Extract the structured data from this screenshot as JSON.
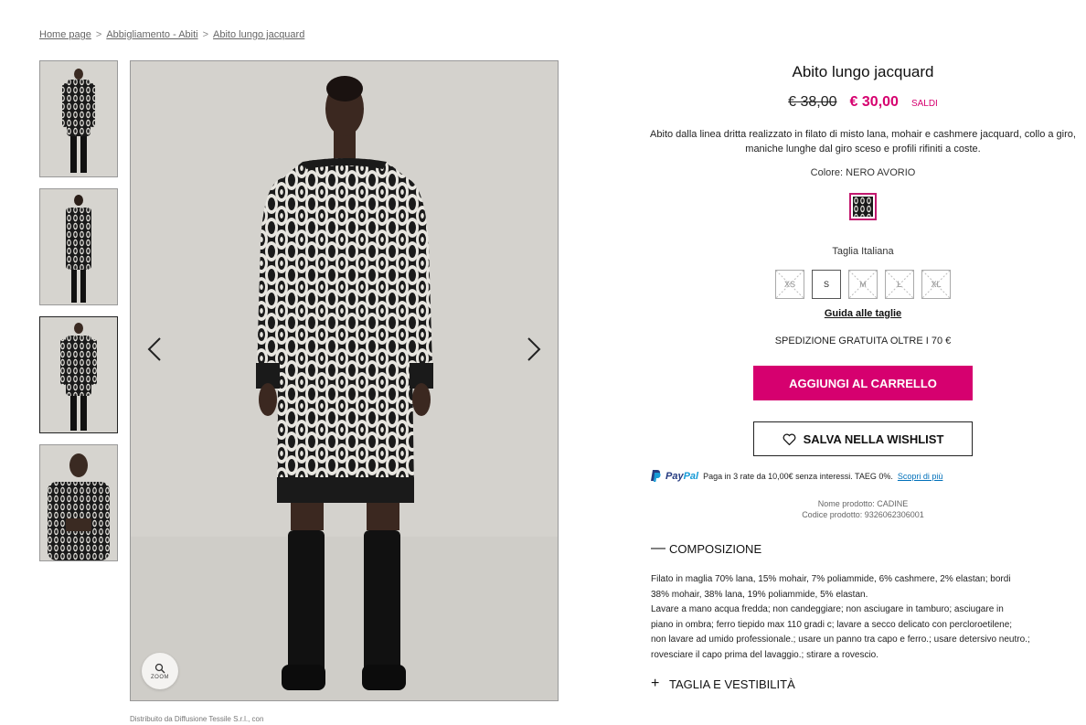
{
  "breadcrumb": {
    "items": [
      "Home page",
      "Abbigliamento - Abiti",
      "Abito lungo jacquard"
    ],
    "separator": ">"
  },
  "gallery": {
    "thumbnails": [
      "front-view",
      "back-view",
      "front-view-2",
      "detail-view"
    ],
    "active_index": 2,
    "zoom_label": "ZOOM",
    "distributed_text": "Distribuito da Diffusione Tessile S.r.l., con"
  },
  "product": {
    "title": "Abito lungo jacquard",
    "old_price": "€ 38,00",
    "new_price": "€ 30,00",
    "sale_label": "SALDI",
    "description": "Abito dalla linea dritta realizzato in filato di misto lana, mohair e cashmere jacquard, collo a giro, maniche lunghe dal giro sceso e profili rifiniti a coste.",
    "color_label": "Colore: NERO AVORIO",
    "size_label": "Taglia Italiana",
    "sizes": [
      {
        "label": "XS",
        "available": false
      },
      {
        "label": "S",
        "available": true
      },
      {
        "label": "M",
        "available": false
      },
      {
        "label": "L",
        "available": false
      },
      {
        "label": "XL",
        "available": false
      }
    ],
    "size_guide": "Guida alle taglie",
    "shipping": "SPEDIZIONE GRATUITA OLTRE I 70 €",
    "add_to_cart": "AGGIUNGI AL CARRELLO",
    "wishlist": "SALVA NELLA WISHLIST",
    "paypal": {
      "logo_pay": "Pay",
      "logo_pal": "Pal",
      "text": "Paga in 3 rate da 10,00€ senza interessi. TAEG 0%.",
      "link": "Scopri di più"
    },
    "product_name": "Nome prodotto: CADINE",
    "product_code": "Codice prodotto:  9326062306001"
  },
  "accordion": {
    "composition_title": "COMPOSIZIONE",
    "composition_lines": [
      "Filato in maglia 70% lana, 15% mohair, 7% poliammide, 6% cashmere, 2% elastan; bordi",
      "38% mohair, 38% lana, 19% poliammide, 5% elastan.",
      "Lavare a mano acqua fredda; non candeggiare; non asciugare in tamburo; asciugare in",
      "piano in ombra; ferro tiepido max 110 gradi c; lavare a secco delicato con percloroetilene;",
      "non lavare ad umido professionale.; usare un panno tra capo e ferro.; usare detersivo neutro.;",
      "rovesciare il capo prima del lavaggio.; stirare a rovescio."
    ],
    "fit_title": "TAGLIA E VESTIBILITÀ"
  },
  "colors": {
    "accent": "#d6006f",
    "paypal_blue": "#253b80",
    "paypal_light": "#179bd7"
  }
}
